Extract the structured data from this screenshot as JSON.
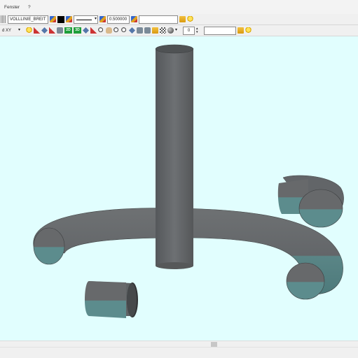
{
  "menubar": {
    "items": [
      "Fenster",
      "?"
    ]
  },
  "toolbar1": {
    "line_style_value": "VOLLLINIE_BREIT",
    "line_width_value": "0.500000",
    "empty_field_value": ""
  },
  "toolbar2": {
    "plane_value": "d XY",
    "two_d_label": "2D",
    "three_d_label": "3D",
    "number_value": "0",
    "empty_field_value": ""
  },
  "colors": {
    "viewport_background": "#e1fefe",
    "solid_top": "#6b6e71",
    "solid_bottom": "#5e8b8d"
  }
}
